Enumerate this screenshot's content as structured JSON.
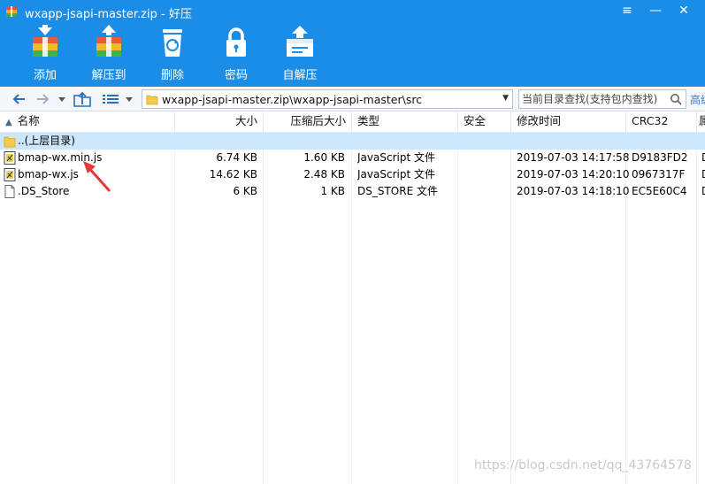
{
  "window": {
    "title": "wxapp-jsapi-master.zip - 好压",
    "menu_glyph": "≡",
    "minimize_glyph": "—",
    "close_glyph": "✕"
  },
  "toolbar": {
    "items": [
      {
        "label": "添加",
        "icon": "add-archive-icon"
      },
      {
        "label": "解压到",
        "icon": "extract-icon"
      },
      {
        "label": "删除",
        "icon": "recycle-bin-icon"
      },
      {
        "label": "密码",
        "icon": "lock-icon"
      },
      {
        "label": "自解压",
        "icon": "self-extract-icon"
      }
    ]
  },
  "address": {
    "path": "wxapp-jsapi-master.zip\\wxapp-jsapi-master\\src",
    "search_placeholder": "当前目录查找(支持包内查找)",
    "advanced_link": "高级"
  },
  "columns": {
    "name": "名称",
    "size": "大小",
    "compressed": "压缩后大小",
    "type": "类型",
    "security": "安全",
    "modified": "修改时间",
    "crc": "CRC32",
    "extra": "属"
  },
  "rows": [
    {
      "name": "..(上层目录)",
      "size": "",
      "compressed": "",
      "type": "",
      "security": "",
      "modified": "",
      "crc": "",
      "extra": "",
      "icon": "folder-icon"
    },
    {
      "name": "bmap-wx.min.js",
      "size": "6.74 KB",
      "compressed": "1.60 KB",
      "type": "JavaScript 文件",
      "security": "",
      "modified": "2019-07-03 14:17:58",
      "crc": "D9183FD2",
      "extra": "D",
      "icon": "js-file-icon"
    },
    {
      "name": "bmap-wx.js",
      "size": "14.62 KB",
      "compressed": "2.48 KB",
      "type": "JavaScript 文件",
      "security": "",
      "modified": "2019-07-03 14:20:10",
      "crc": "0967317F",
      "extra": "D",
      "icon": "js-file-icon"
    },
    {
      "name": ".DS_Store",
      "size": "6 KB",
      "compressed": "1 KB",
      "type": "DS_STORE 文件",
      "security": "",
      "modified": "2019-07-03 14:18:10",
      "crc": "EC5E60C4",
      "extra": "D",
      "icon": "file-icon"
    }
  ],
  "watermark": "https://blog.csdn.net/qq_43764578",
  "colors": {
    "ribbon": "#1c8de6",
    "selected_row": "#cce6fb",
    "annotation_arrow": "#e53935"
  }
}
